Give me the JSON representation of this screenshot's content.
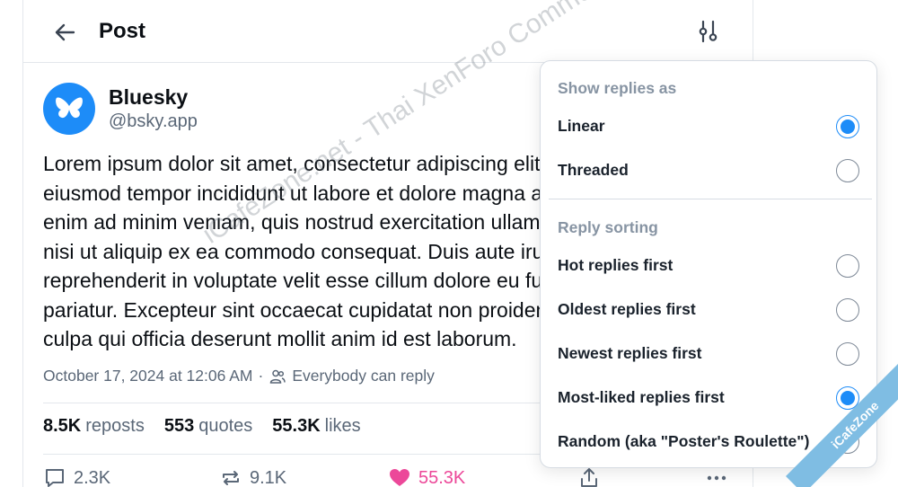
{
  "header": {
    "title": "Post",
    "back_icon": "arrow-left-icon",
    "filter_icon": "sliders-icon"
  },
  "author": {
    "display_name": "Bluesky",
    "handle": "@bsky.app",
    "avatar_icon": "butterfly-icon"
  },
  "post": {
    "lines": [
      "Lorem ipsum dolor sit amet, consectetur adipiscing elit, sed do",
      "eiusmod tempor incididunt ut labore et dolore magna aliqua. Ut",
      "enim ad minim veniam, quis nostrud exercitation ullamco laboris",
      "nisi ut aliquip ex ea commodo consequat. Duis aute irure dolor in",
      "reprehenderit in voluptate velit esse cillum dolore eu fugiat nulla",
      "pariatur. Excepteur sint occaecat cupidatat non proident, sunt in",
      "culpa qui officia deserunt mollit anim id est laborum."
    ],
    "timestamp": "October 17, 2024 at 12:06 AM",
    "separator": "·",
    "reply_setting": "Everybody can reply"
  },
  "stats": {
    "reposts_count": "8.5K",
    "reposts_label": "reposts",
    "quotes_count": "553",
    "quotes_label": "quotes",
    "likes_count": "55.3K",
    "likes_label": "likes"
  },
  "actions": {
    "replies": "2.3K",
    "reposts": "9.1K",
    "likes": "55.3K"
  },
  "menu": {
    "show_heading": "Show replies as",
    "show_options": [
      {
        "label": "Linear",
        "selected": true
      },
      {
        "label": "Threaded",
        "selected": false
      }
    ],
    "sort_heading": "Reply sorting",
    "sort_options": [
      {
        "label": "Hot replies first",
        "selected": false
      },
      {
        "label": "Oldest replies first",
        "selected": false
      },
      {
        "label": "Newest replies first",
        "selected": false
      },
      {
        "label": "Most-liked replies first",
        "selected": true
      },
      {
        "label": "Random (aka \"Poster's Roulette\")",
        "selected": false
      }
    ]
  },
  "watermark": "iCafeZone.net - Thai XenForo Community",
  "ribbon": "iCafeZone",
  "colors": {
    "accent": "#1d8cf8",
    "like": "#ec4899",
    "muted": "#5a6777"
  }
}
